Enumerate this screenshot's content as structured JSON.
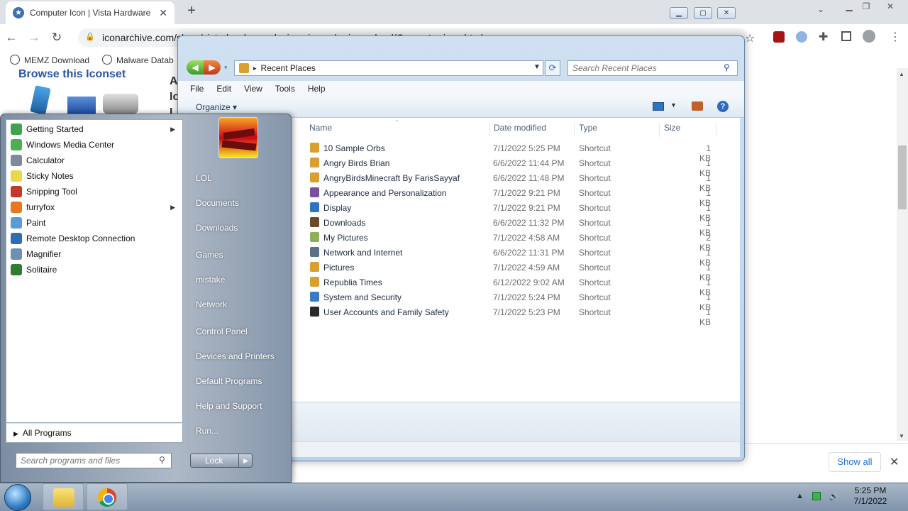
{
  "browser": {
    "tab_title": "Computer Icon | Vista Hardware",
    "tab_close": "✕",
    "new_tab": "+",
    "url": "iconarchive.com/show/vista-hardware-devices-icons-by-icons-land/Computer-icon.html",
    "bookmarks": [
      "MEMZ Download",
      "Malware Datab"
    ],
    "page_heading": "Browse this Iconset",
    "page_letters": [
      "A",
      "Ic",
      "I"
    ],
    "show_all": "Show all",
    "dl_close": "✕"
  },
  "explorer": {
    "address": "Recent Places",
    "search_placeholder": "Search Recent Places",
    "menu": [
      "File",
      "Edit",
      "View",
      "Tools",
      "Help"
    ],
    "organize": "Organize ▾",
    "columns": [
      "Name",
      "Date modified",
      "Type",
      "Size"
    ],
    "files": [
      {
        "name": "10 Sample Orbs",
        "date": "7/1/2022 5:25 PM",
        "type": "Shortcut",
        "size": "1 KB",
        "color": "#d9a030"
      },
      {
        "name": "Angry Birds Brian",
        "date": "6/6/2022 11:44 PM",
        "type": "Shortcut",
        "size": "1 KB",
        "color": "#d9a030"
      },
      {
        "name": "AngryBirdsMinecraft By FarisSayyaf",
        "date": "6/6/2022 11:48 PM",
        "type": "Shortcut",
        "size": "1 KB",
        "color": "#d9a030"
      },
      {
        "name": "Appearance and Personalization",
        "date": "7/1/2022 9:21 PM",
        "type": "Shortcut",
        "size": "1 KB",
        "color": "#7a4f9e"
      },
      {
        "name": "Display",
        "date": "7/1/2022 9:21 PM",
        "type": "Shortcut",
        "size": "1 KB",
        "color": "#2f74c0"
      },
      {
        "name": "Downloads",
        "date": "6/6/2022 11:32 PM",
        "type": "Shortcut",
        "size": "1 KB",
        "color": "#6b4a2a"
      },
      {
        "name": "My Pictures",
        "date": "7/1/2022 4:58 AM",
        "type": "Shortcut",
        "size": "2 KB",
        "color": "#8fae5a"
      },
      {
        "name": "Network and Internet",
        "date": "6/6/2022 11:31 PM",
        "type": "Shortcut",
        "size": "1 KB",
        "color": "#5a6f8a"
      },
      {
        "name": "Pictures",
        "date": "7/1/2022 4:59 AM",
        "type": "Shortcut",
        "size": "1 KB",
        "color": "#d9a030"
      },
      {
        "name": "Republia Times",
        "date": "6/12/2022 9:02 AM",
        "type": "Shortcut",
        "size": "1 KB",
        "color": "#d9a030"
      },
      {
        "name": "System and Security",
        "date": "7/1/2022 5:24 PM",
        "type": "Shortcut",
        "size": "1 KB",
        "color": "#3a7bc8"
      },
      {
        "name": "User Accounts and Family Safety",
        "date": "7/1/2022 5:23 PM",
        "type": "Shortcut",
        "size": "1 KB",
        "color": "#2a2a2a"
      }
    ]
  },
  "startmenu": {
    "programs": [
      {
        "label": "Getting Started",
        "color": "#3fa34d",
        "submenu": true
      },
      {
        "label": "Windows Media Center",
        "color": "#4caf50",
        "submenu": false
      },
      {
        "label": "Calculator",
        "color": "#7d8b99",
        "submenu": false
      },
      {
        "label": "Sticky Notes",
        "color": "#e8d84a",
        "submenu": false
      },
      {
        "label": "Snipping Tool",
        "color": "#c0392b",
        "submenu": false
      },
      {
        "label": "furryfox",
        "color": "#e8781f",
        "submenu": true
      },
      {
        "label": "Paint",
        "color": "#5b9bd5",
        "submenu": false
      },
      {
        "label": "Remote Desktop Connection",
        "color": "#2e6db4",
        "submenu": false
      },
      {
        "label": "Magnifier",
        "color": "#6d8fb1",
        "submenu": false
      },
      {
        "label": "Solitaire",
        "color": "#2e7d32",
        "submenu": false
      }
    ],
    "all_programs": "All Programs",
    "search_placeholder": "Search programs and files",
    "right_links": [
      "LOL",
      "Documents",
      "Downloads",
      "Games",
      "mistake",
      "Network",
      "Control Panel",
      "Devices and Printers",
      "Default Programs",
      "Help and Support",
      "Run..."
    ],
    "lock": "Lock"
  },
  "taskbar": {
    "time": "5:25 PM",
    "date": "7/1/2022"
  }
}
